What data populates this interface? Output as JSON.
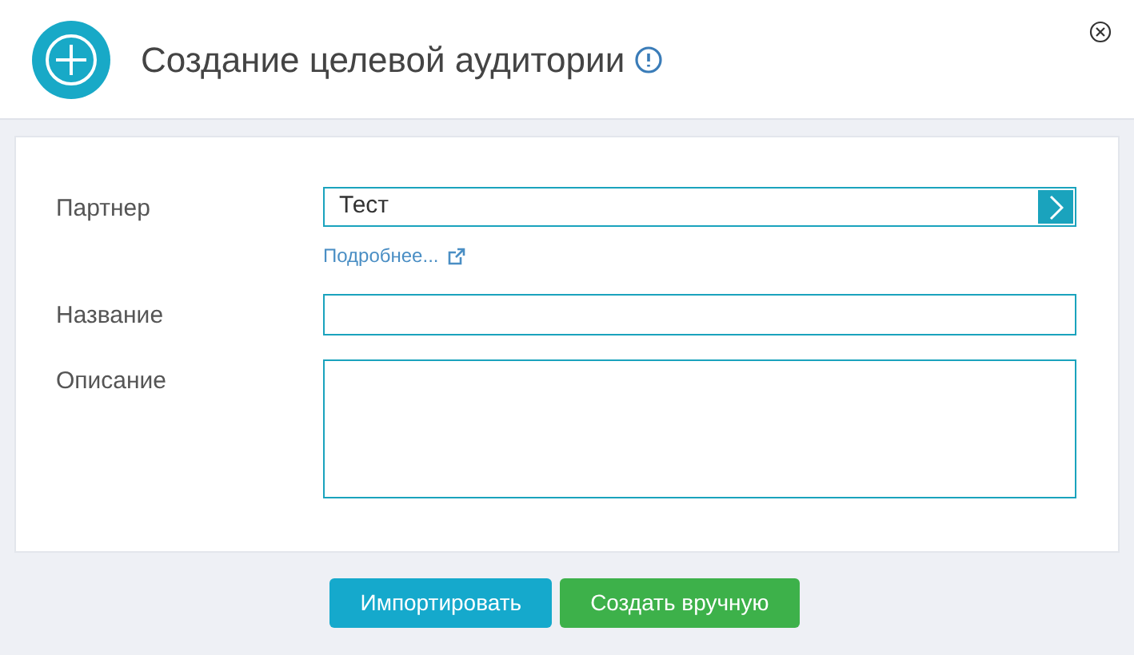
{
  "dialog": {
    "title": "Создание целевой аудитории"
  },
  "fields": [
    {
      "kind": "select",
      "label": "Партнер",
      "value": "Тест",
      "link": "Подробнее..."
    },
    {
      "kind": "text",
      "label": "Название"
    },
    {
      "kind": "textarea",
      "label": "Описание"
    }
  ],
  "buttons": [
    {
      "label": "Импортировать",
      "kind": "import"
    },
    {
      "label": "Создать вручную",
      "kind": "create"
    }
  ]
}
